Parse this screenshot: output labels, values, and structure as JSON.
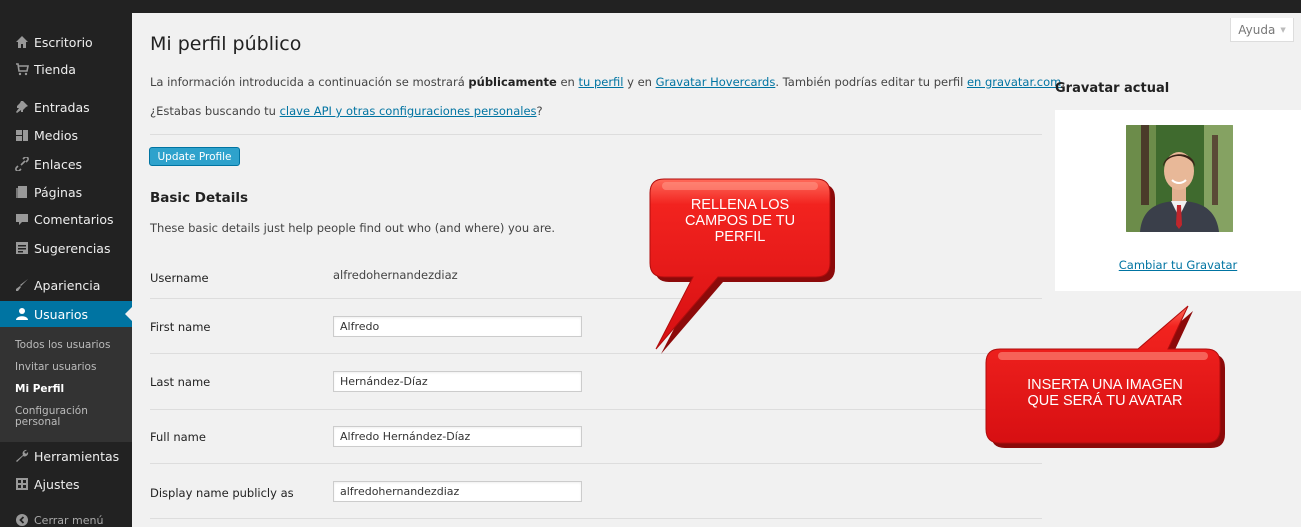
{
  "sidebar": {
    "items": [
      {
        "label": "Escritorio",
        "icon": "home-icon"
      },
      {
        "label": "Tienda",
        "icon": "cart-icon"
      },
      {
        "label": "Entradas",
        "icon": "pin-icon"
      },
      {
        "label": "Medios",
        "icon": "media-icon"
      },
      {
        "label": "Enlaces",
        "icon": "link-icon"
      },
      {
        "label": "Páginas",
        "icon": "page-icon"
      },
      {
        "label": "Comentarios",
        "icon": "comment-icon"
      },
      {
        "label": "Sugerencias",
        "icon": "feedback-icon"
      },
      {
        "label": "Apariencia",
        "icon": "brush-icon"
      },
      {
        "label": "Usuarios",
        "icon": "user-icon"
      },
      {
        "label": "Herramientas",
        "icon": "wrench-icon"
      },
      {
        "label": "Ajustes",
        "icon": "settings-icon"
      },
      {
        "label": "Cerrar menú",
        "icon": "collapse-icon"
      }
    ],
    "submenu": [
      "Todos los usuarios",
      "Invitar usuarios",
      "Mi Perfil",
      "Configuración personal"
    ]
  },
  "help": {
    "label": "Ayuda",
    "arrow": "▼"
  },
  "page": {
    "title": "Mi perfil público",
    "intro1": {
      "t1": "La información introducida a continuación se mostrará ",
      "bold": "públicamente",
      "t2": " en ",
      "link1": "tu perfil",
      "t3": " y en ",
      "link2": "Gravatar Hovercards",
      "t4": ". También podrías editar tu perfil ",
      "link3": "en gravatar.com",
      "t5": "."
    },
    "intro2": {
      "t1": "¿Estabas buscando tu ",
      "link": "clave API y otras configuraciones personales",
      "t2": "?"
    },
    "update_button": "Update Profile",
    "section_title": "Basic Details",
    "section_desc": "These basic details just help people find out who (and where) you are.",
    "fields": {
      "username": {
        "label": "Username",
        "value": "alfredohernandezdiaz"
      },
      "first_name": {
        "label": "First name",
        "value": "Alfredo"
      },
      "last_name": {
        "label": "Last name",
        "value": "Hernández-Díaz"
      },
      "full_name": {
        "label": "Full name",
        "value": "Alfredo Hernández-Díaz"
      },
      "display_name": {
        "label": "Display name publicly as",
        "value": "alfredohernandezdiaz"
      }
    }
  },
  "gravatar": {
    "title": "Gravatar actual",
    "change_link": "Cambiar tu Gravatar"
  },
  "callouts": {
    "profile": [
      "RELLENA LOS",
      "CAMPOS DE TU",
      "PERFIL"
    ],
    "avatar": [
      "INSERTA UNA IMAGEN",
      "QUE SERÁ TU AVATAR"
    ]
  },
  "colors": {
    "sidebar": "#222222",
    "active_menu": "#0074a2",
    "link": "#0074a2",
    "button": "#2ea2cc",
    "callout": "#e8161b"
  }
}
